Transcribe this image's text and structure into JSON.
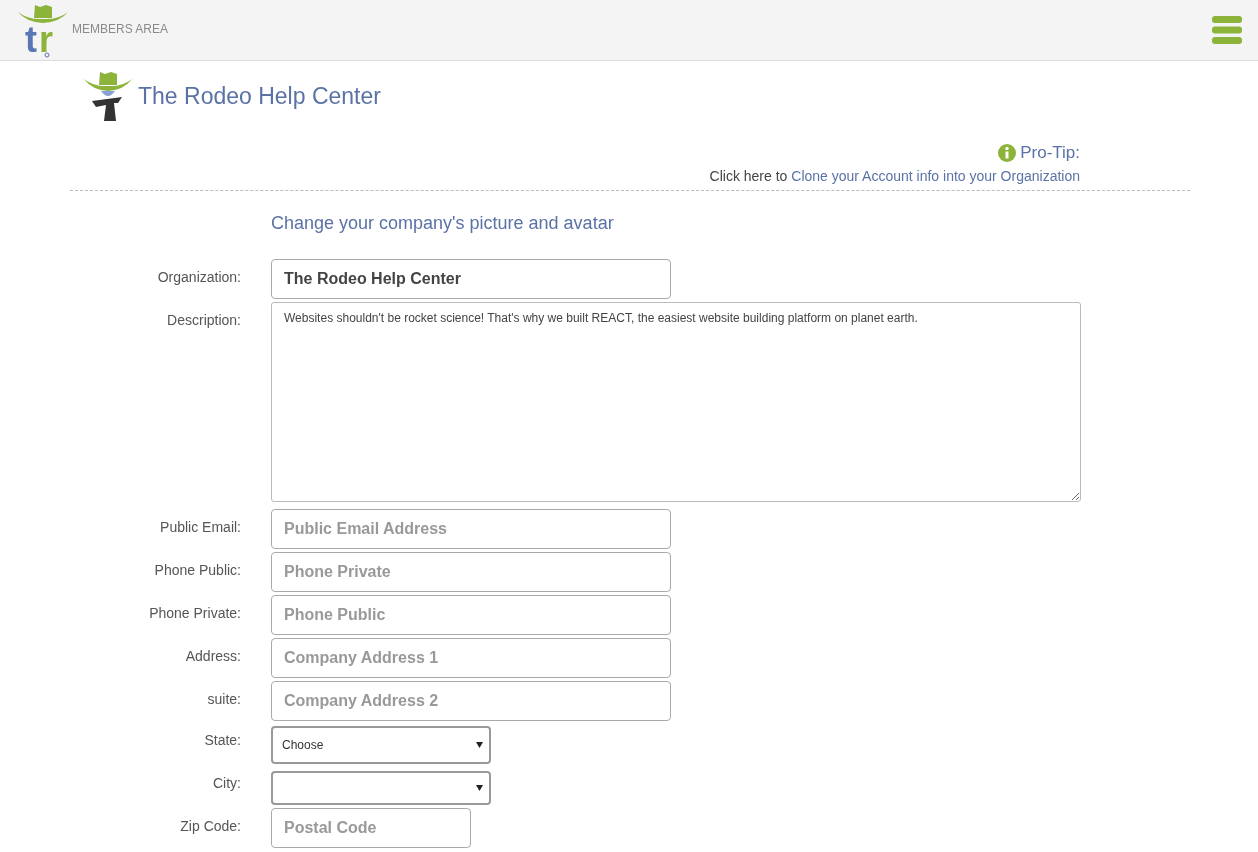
{
  "header": {
    "logo_letters": [
      "t",
      "r"
    ],
    "brand": "MEMBERS AREA"
  },
  "page": {
    "title": "The Rodeo Help Center"
  },
  "pro_tip": {
    "label": "Pro-Tip:",
    "prefix": "Click here to",
    "link": "Clone your Account info into your Organization"
  },
  "form": {
    "heading": "Change your company's picture and avatar",
    "fields": [
      {
        "kind": "input",
        "label": "Organization:",
        "value": "The Rodeo Help Center"
      },
      {
        "kind": "textarea",
        "label": "Description:",
        "value": "Websites shouldn't be rocket science! That's why we built REACT, the easiest website building platform on planet earth."
      },
      {
        "kind": "input",
        "label": "Public Email:",
        "placeholder": "Public Email Address"
      },
      {
        "kind": "input",
        "label": "Phone Public:",
        "placeholder": "Phone Private"
      },
      {
        "kind": "input",
        "label": "Phone Private:",
        "placeholder": "Phone Public"
      },
      {
        "kind": "input",
        "label": "Address:",
        "placeholder": "Company Address 1"
      },
      {
        "kind": "input",
        "label": "suite:",
        "placeholder": "Company Address 2"
      },
      {
        "kind": "select",
        "label": "State:",
        "value": "Choose"
      },
      {
        "kind": "select",
        "label": "City:"
      },
      {
        "kind": "short",
        "label": "Zip Code:",
        "placeholder": "Postal Code"
      }
    ]
  }
}
